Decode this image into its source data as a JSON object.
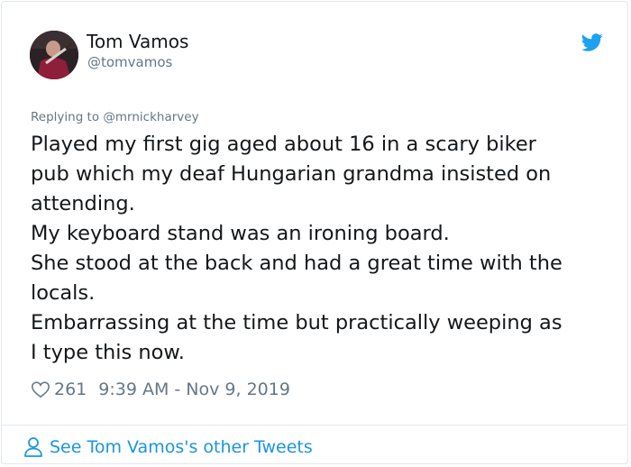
{
  "tweet": {
    "author_name": "Tom Vamos",
    "author_handle": "@tomvamos",
    "replying_prefix": "Replying to ",
    "replying_to": "@mrnickharvey",
    "body_lines": [
      "Played my first gig aged about 16 in a scary biker",
      "pub which my deaf Hungarian grandma insisted on",
      "attending.",
      "My keyboard stand was an ironing board.",
      "She stood at the back and had a great time with the",
      "locals.",
      "Embarrassing at the time but practically weeping as",
      "I type this now."
    ],
    "likes": "261",
    "timestamp": "9:39 AM - Nov 9, 2019"
  },
  "footer": {
    "link_text": "See Tom Vamos's other Tweets"
  },
  "icons": {
    "brand": "twitter-bird-icon",
    "like": "heart-icon",
    "profile": "person-icon"
  },
  "colors": {
    "brand": "#1da1f2",
    "link": "#1b95e0",
    "text": "#14171a",
    "muted": "#657786",
    "border": "#e1e8ed"
  }
}
